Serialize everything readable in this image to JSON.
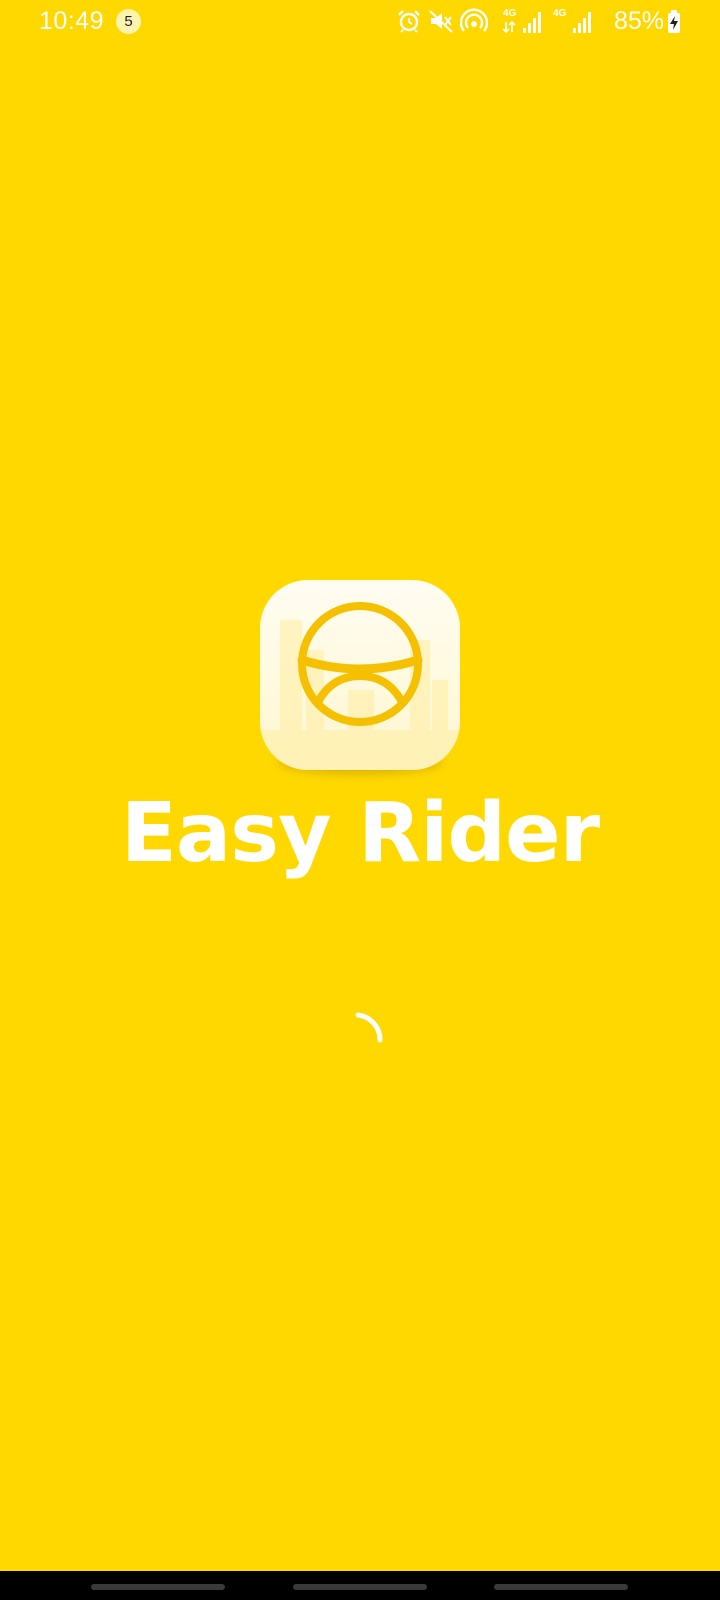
{
  "status_bar": {
    "time": "10:49",
    "notification_count": "5",
    "battery": "85%",
    "icons": [
      "alarm-icon",
      "mute-icon",
      "hotspot-icon",
      "signal-4g-icon",
      "signal-4g-icon",
      "charging-battery-icon"
    ],
    "network_label_1": "4G",
    "network_label_2": "4G"
  },
  "splash": {
    "app_name": "Easy Rider",
    "logo_icon": "steering-wheel-icon",
    "background_color": "#FFD800",
    "accent_color": "#F5C400"
  },
  "loading": {
    "indicator": "spinner-icon"
  }
}
